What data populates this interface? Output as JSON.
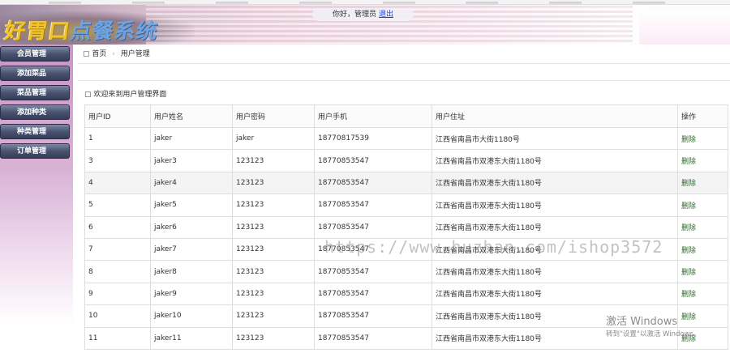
{
  "header": {
    "logo_part1": "好胃口",
    "logo_part2": "点餐系统",
    "greeting": "你好，管理员",
    "logout": "退出"
  },
  "sidebar": {
    "items": [
      {
        "label": "会员管理"
      },
      {
        "label": "添加菜品"
      },
      {
        "label": "菜品管理"
      },
      {
        "label": "添加种类"
      },
      {
        "label": "种类管理"
      },
      {
        "label": "订单管理"
      }
    ]
  },
  "breadcrumb": {
    "home": "首页",
    "current": "用户管理"
  },
  "intro_text": "欢迎来到用户管理界面",
  "table": {
    "headers": [
      "用户ID",
      "用户姓名",
      "用户密码",
      "用户手机",
      "用户住址",
      "操作"
    ],
    "rows": [
      {
        "id": "1",
        "name": "jaker",
        "password": "jaker",
        "phone": "18770817539",
        "address": "江西省南昌市大街1180号",
        "action": "删除"
      },
      {
        "id": "3",
        "name": "jaker3",
        "password": "123123",
        "phone": "18770853547",
        "address": "江西省南昌市双港东大街1180号",
        "action": "删除"
      },
      {
        "id": "4",
        "name": "jaker4",
        "password": "123123",
        "phone": "18770853547",
        "address": "江西省南昌市双港东大街1180号",
        "action": "删除"
      },
      {
        "id": "5",
        "name": "jaker5",
        "password": "123123",
        "phone": "18770853547",
        "address": "江西省南昌市双港东大街1180号",
        "action": "删除"
      },
      {
        "id": "6",
        "name": "jaker6",
        "password": "123123",
        "phone": "18770853547",
        "address": "江西省南昌市双港东大街1180号",
        "action": "删除"
      },
      {
        "id": "7",
        "name": "jaker7",
        "password": "123123",
        "phone": "18770853547",
        "address": "江西省南昌市双港东大街1180号",
        "action": "删除"
      },
      {
        "id": "8",
        "name": "jaker8",
        "password": "123123",
        "phone": "18770853547",
        "address": "江西省南昌市双港东大街1180号",
        "action": "删除"
      },
      {
        "id": "9",
        "name": "jaker9",
        "password": "123123",
        "phone": "18770853547",
        "address": "江西省南昌市双港东大街1180号",
        "action": "删除"
      },
      {
        "id": "10",
        "name": "jaker10",
        "password": "123123",
        "phone": "18770853547",
        "address": "江西省南昌市双港东大街1180号",
        "action": "删除"
      },
      {
        "id": "11",
        "name": "jaker11",
        "password": "123123",
        "phone": "18770853547",
        "address": "江西省南昌市双港东大街1180号",
        "action": "删除"
      }
    ]
  },
  "overlay": {
    "watermark": "https://www.huzhan.com/ishop3572",
    "activation_title": "激活 Windows",
    "activation_sub": "转到\"设置\"以激活 Windows。"
  },
  "icons": {
    "home": "home-icon",
    "intro": "info-icon"
  }
}
